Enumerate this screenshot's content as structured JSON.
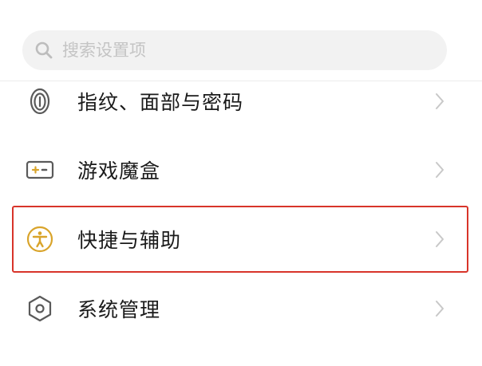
{
  "search": {
    "placeholder": "搜索设置项",
    "value": "",
    "icon": "search-icon"
  },
  "settings": {
    "items": [
      {
        "label": "指纹、面部与密码",
        "icon": "fingerprint-icon",
        "highlighted": false
      },
      {
        "label": "游戏魔盒",
        "icon": "game-box-icon",
        "highlighted": false
      },
      {
        "label": "快捷与辅助",
        "icon": "accessibility-icon",
        "highlighted": true
      },
      {
        "label": "系统管理",
        "icon": "system-management-icon",
        "highlighted": false
      }
    ]
  },
  "colors": {
    "background": "#ffffff",
    "search_bg": "#f2f2f2",
    "icon_gray": "#5a5a5a",
    "accessibility_gold": "#d9a42b",
    "highlight_red": "#d8342a",
    "chevron": "#c8c8c8"
  }
}
